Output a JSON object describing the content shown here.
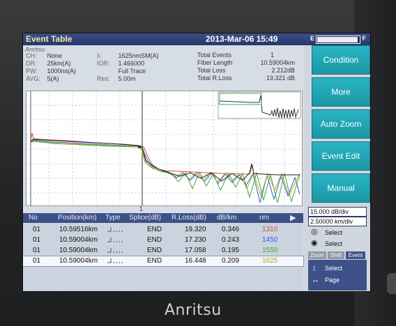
{
  "title": {
    "label": "Event Table",
    "datetime": "2013-Mar-06 15:49"
  },
  "battery": {
    "left": "E",
    "right": "F",
    "level": 0.97
  },
  "device": {
    "brand_small": "Anritsu"
  },
  "left_params": [
    {
      "k": "CH:",
      "v": "None"
    },
    {
      "k": "DR:",
      "v": "25km(A)"
    },
    {
      "k": "PW:",
      "v": "1000ns(A)"
    },
    {
      "k": "AVG:",
      "v": "5(A)"
    }
  ],
  "mid_params": [
    {
      "k": "λ:",
      "v": "1625nmSM(A)"
    },
    {
      "k": "IOR:",
      "v": "1.466000"
    },
    {
      "k": "",
      "v": "Full Trace"
    },
    {
      "k": "Res:",
      "v": "5.00m"
    }
  ],
  "totals": [
    {
      "k": "Total Events",
      "v": "1"
    },
    {
      "k": "Fiber Length",
      "v": "10.59004km"
    },
    {
      "k": "Total Loss",
      "v": "2.212dB"
    },
    {
      "k": "Total R.Loss",
      "v": "19.321 dB"
    }
  ],
  "plot": {
    "marker_label": "1"
  },
  "table": {
    "headers": [
      "No",
      "Position(km)",
      "Type",
      "Splice(dB)",
      "R.Loss(dB)",
      "dB/km",
      "nm"
    ],
    "rows": [
      {
        "no": "01",
        "pos": "10.59516km",
        "splice": "END",
        "rloss": "19.320",
        "dbkm": "0.346",
        "nm": "1310",
        "nm_color": "#d94a3a"
      },
      {
        "no": "01",
        "pos": "10.59004km",
        "splice": "END",
        "rloss": "17.230",
        "dbkm": "0.243",
        "nm": "1450",
        "nm_color": "#3a5bd9"
      },
      {
        "no": "01",
        "pos": "10.59004km",
        "splice": "END",
        "rloss": "17.058",
        "dbkm": "0.195",
        "nm": "1550",
        "nm_color": "#3fa64a"
      },
      {
        "no": "01",
        "pos": "10.59004km",
        "splice": "END",
        "rloss": "16.448",
        "dbkm": "0.209",
        "nm": "1625",
        "nm_color": "#a7b11d"
      }
    ]
  },
  "side": {
    "buttons": [
      "Condition",
      "More",
      "Auto Zoom",
      "Event Edit",
      "Manual"
    ],
    "scale_db": "15.000 dB/div",
    "scale_km": "2.50000 km/div",
    "select1": "Select",
    "select2": "Select",
    "tabs": [
      "Zoom",
      "Shift",
      "Event"
    ],
    "nav_select": "Select",
    "nav_page": "Page"
  },
  "bezel": {
    "logo": "Anritsu"
  }
}
